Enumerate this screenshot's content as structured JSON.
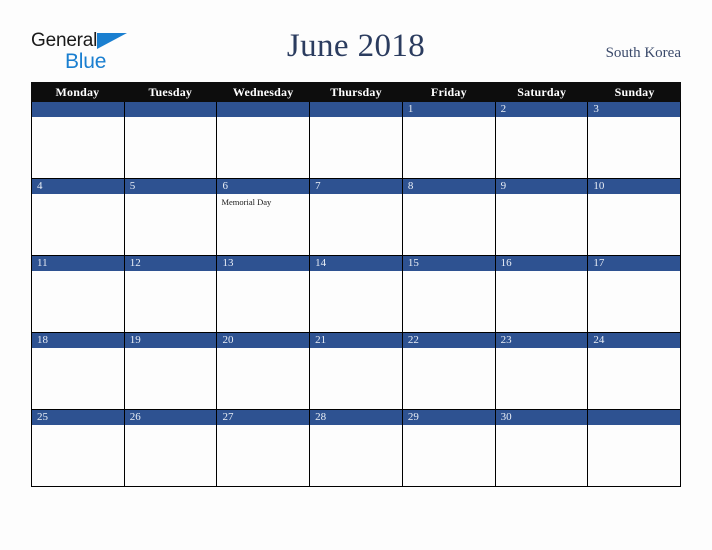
{
  "branding": {
    "logo_word_one": "General",
    "logo_word_two": "Blue",
    "logo_triangle_icon": "triangle-icon",
    "logo_primary_color": "#1a7fd0",
    "logo_text_color": "#1a1a1a"
  },
  "header": {
    "title": "June 2018",
    "country": "South Korea",
    "title_color": "#2b3c5f",
    "country_color": "#3b4a6b"
  },
  "theme": {
    "page_background": "#fdfdfd",
    "weekday_header_background": "#0d0d0d",
    "weekday_header_text": "#ffffff",
    "day_bar_background": "#2e5291",
    "day_number_text": "#e9eef6",
    "grid_border": "#000000",
    "cell_background": "#fdfdfd",
    "event_text_color": "#1a1a1a"
  },
  "calendar": {
    "weekdays": [
      "Monday",
      "Tuesday",
      "Wednesday",
      "Thursday",
      "Friday",
      "Saturday",
      "Sunday"
    ],
    "weeks": [
      [
        {
          "number": "",
          "events": []
        },
        {
          "number": "",
          "events": []
        },
        {
          "number": "",
          "events": []
        },
        {
          "number": "",
          "events": []
        },
        {
          "number": "1",
          "events": []
        },
        {
          "number": "2",
          "events": []
        },
        {
          "number": "3",
          "events": []
        }
      ],
      [
        {
          "number": "4",
          "events": []
        },
        {
          "number": "5",
          "events": []
        },
        {
          "number": "6",
          "events": [
            "Memorial Day"
          ]
        },
        {
          "number": "7",
          "events": []
        },
        {
          "number": "8",
          "events": []
        },
        {
          "number": "9",
          "events": []
        },
        {
          "number": "10",
          "events": []
        }
      ],
      [
        {
          "number": "11",
          "events": []
        },
        {
          "number": "12",
          "events": []
        },
        {
          "number": "13",
          "events": []
        },
        {
          "number": "14",
          "events": []
        },
        {
          "number": "15",
          "events": []
        },
        {
          "number": "16",
          "events": []
        },
        {
          "number": "17",
          "events": []
        }
      ],
      [
        {
          "number": "18",
          "events": []
        },
        {
          "number": "19",
          "events": []
        },
        {
          "number": "20",
          "events": []
        },
        {
          "number": "21",
          "events": []
        },
        {
          "number": "22",
          "events": []
        },
        {
          "number": "23",
          "events": []
        },
        {
          "number": "24",
          "events": []
        }
      ],
      [
        {
          "number": "25",
          "events": []
        },
        {
          "number": "26",
          "events": []
        },
        {
          "number": "27",
          "events": []
        },
        {
          "number": "28",
          "events": []
        },
        {
          "number": "29",
          "events": []
        },
        {
          "number": "30",
          "events": []
        },
        {
          "number": "",
          "events": []
        }
      ]
    ]
  }
}
